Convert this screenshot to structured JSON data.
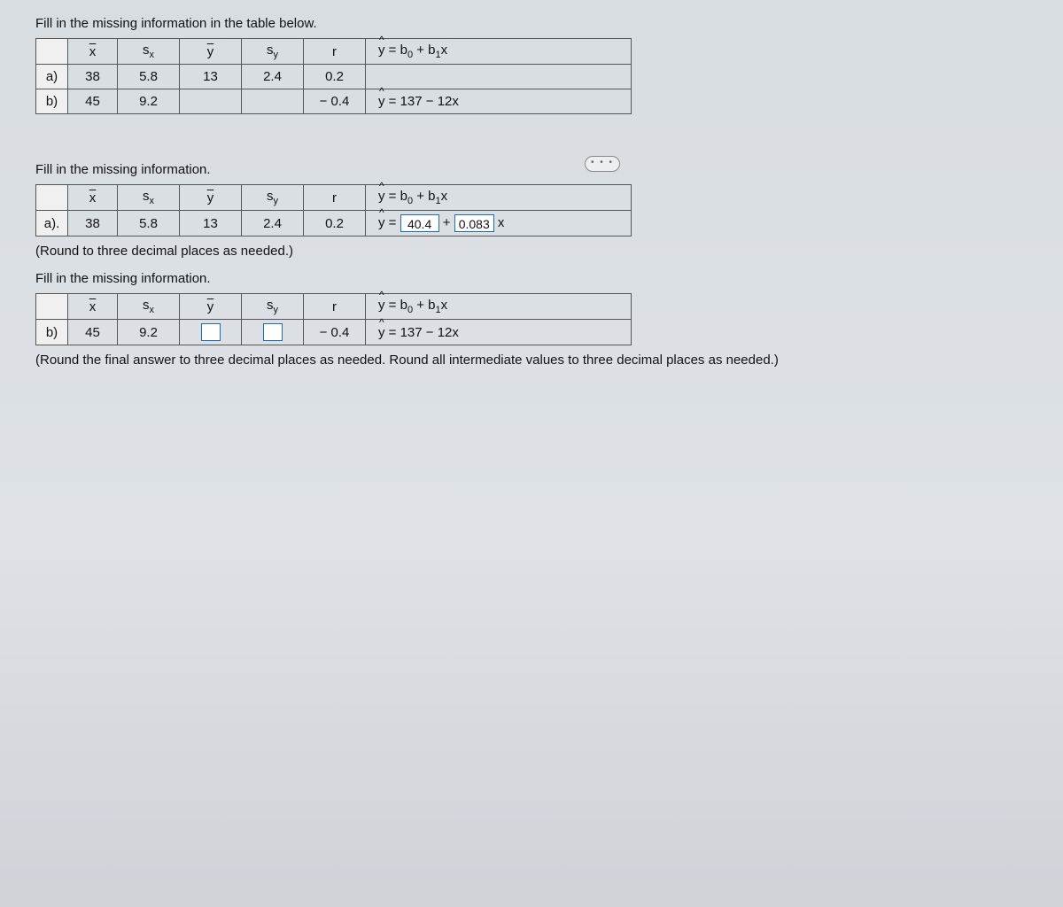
{
  "top_instruction": "Fill in the missing information in the table below.",
  "headers": {
    "xbar": "x",
    "sx": "s",
    "sx_sub": "x",
    "ybar": "y",
    "sy": "s",
    "sy_sub": "y",
    "r": "r",
    "eq_prefix": "y",
    "eq_body": " = b",
    "eq_sub0": "0",
    "eq_mid": " + b",
    "eq_sub1": "1",
    "eq_tail": "x"
  },
  "table1": {
    "a_label": "a)",
    "a_x": "38",
    "a_sx": "5.8",
    "a_y": "13",
    "a_sy": "2.4",
    "a_r": "0.2",
    "a_eq": "",
    "b_label": "b)",
    "b_x": "45",
    "b_sx": "9.2",
    "b_y": "",
    "b_sy": "",
    "b_r": "− 0.4",
    "b_eq_pre": "y",
    "b_eq_body": " = 137 − 12x"
  },
  "mid_instruction": "Fill in the missing information.",
  "table2": {
    "a_label": "a).",
    "a_x": "38",
    "a_sx": "5.8",
    "a_y": "13",
    "a_sy": "2.4",
    "a_r": "0.2",
    "ans_b0": "40.4",
    "ans_plus": " + ",
    "ans_b1": "0.083",
    "ans_tail": " x"
  },
  "hint2": "(Round to three decimal places as needed.)",
  "mid_instruction3": "Fill in the missing information.",
  "table3": {
    "b_label": "b)",
    "b_x": "45",
    "b_sx": "9.2",
    "b_r": "− 0.4",
    "b_eq_pre": "y",
    "b_eq_body": " = 137 − 12x"
  },
  "hint3": "(Round the final answer to three decimal places as needed. Round all intermediate values to three decimal places as needed.)",
  "ellipsis": "• • •"
}
